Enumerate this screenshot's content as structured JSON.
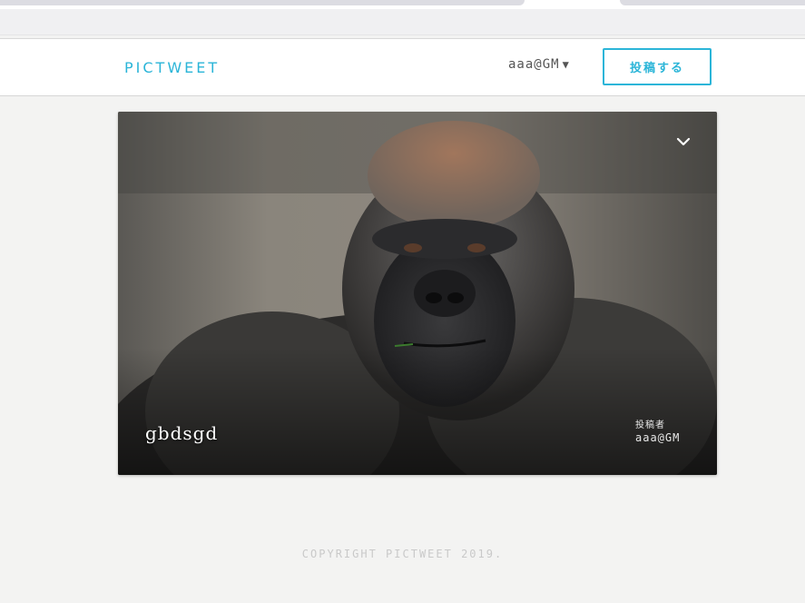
{
  "header": {
    "logo": "pictweet",
    "user_menu_label": "aaa@GM",
    "post_button_label": "投稿する"
  },
  "card": {
    "title": "gbdsgd",
    "author_label": "投稿者",
    "author_name": "aaa@GM",
    "menu_icon": "chevron-down-icon",
    "image": "gorilla-photo"
  },
  "footer": {
    "copyright": "Copyright Pictweet 2019."
  },
  "colors": {
    "accent": "#2bb5d8",
    "page_background": "#f3f3f2",
    "header_background": "#ffffff"
  }
}
